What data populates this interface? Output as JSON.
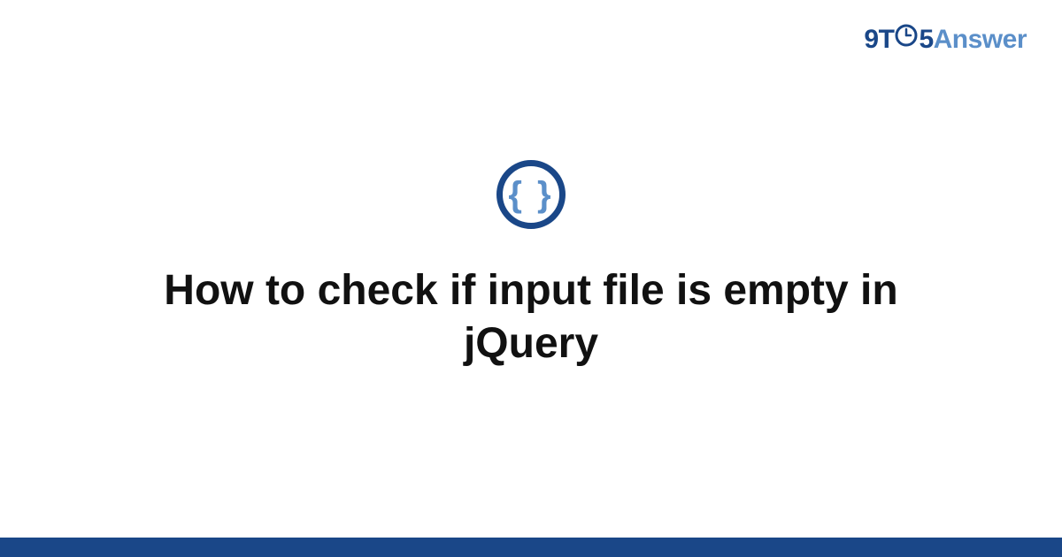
{
  "logo": {
    "part1": "9T",
    "part2": "5",
    "part3": "Answer"
  },
  "category_icon": {
    "name": "code-braces-icon",
    "glyph": "{ }"
  },
  "title": "How to check if input file is empty in jQuery",
  "colors": {
    "brand_primary": "#1a4788",
    "brand_secondary": "#5b8fc9",
    "text": "#111111",
    "background": "#ffffff"
  }
}
